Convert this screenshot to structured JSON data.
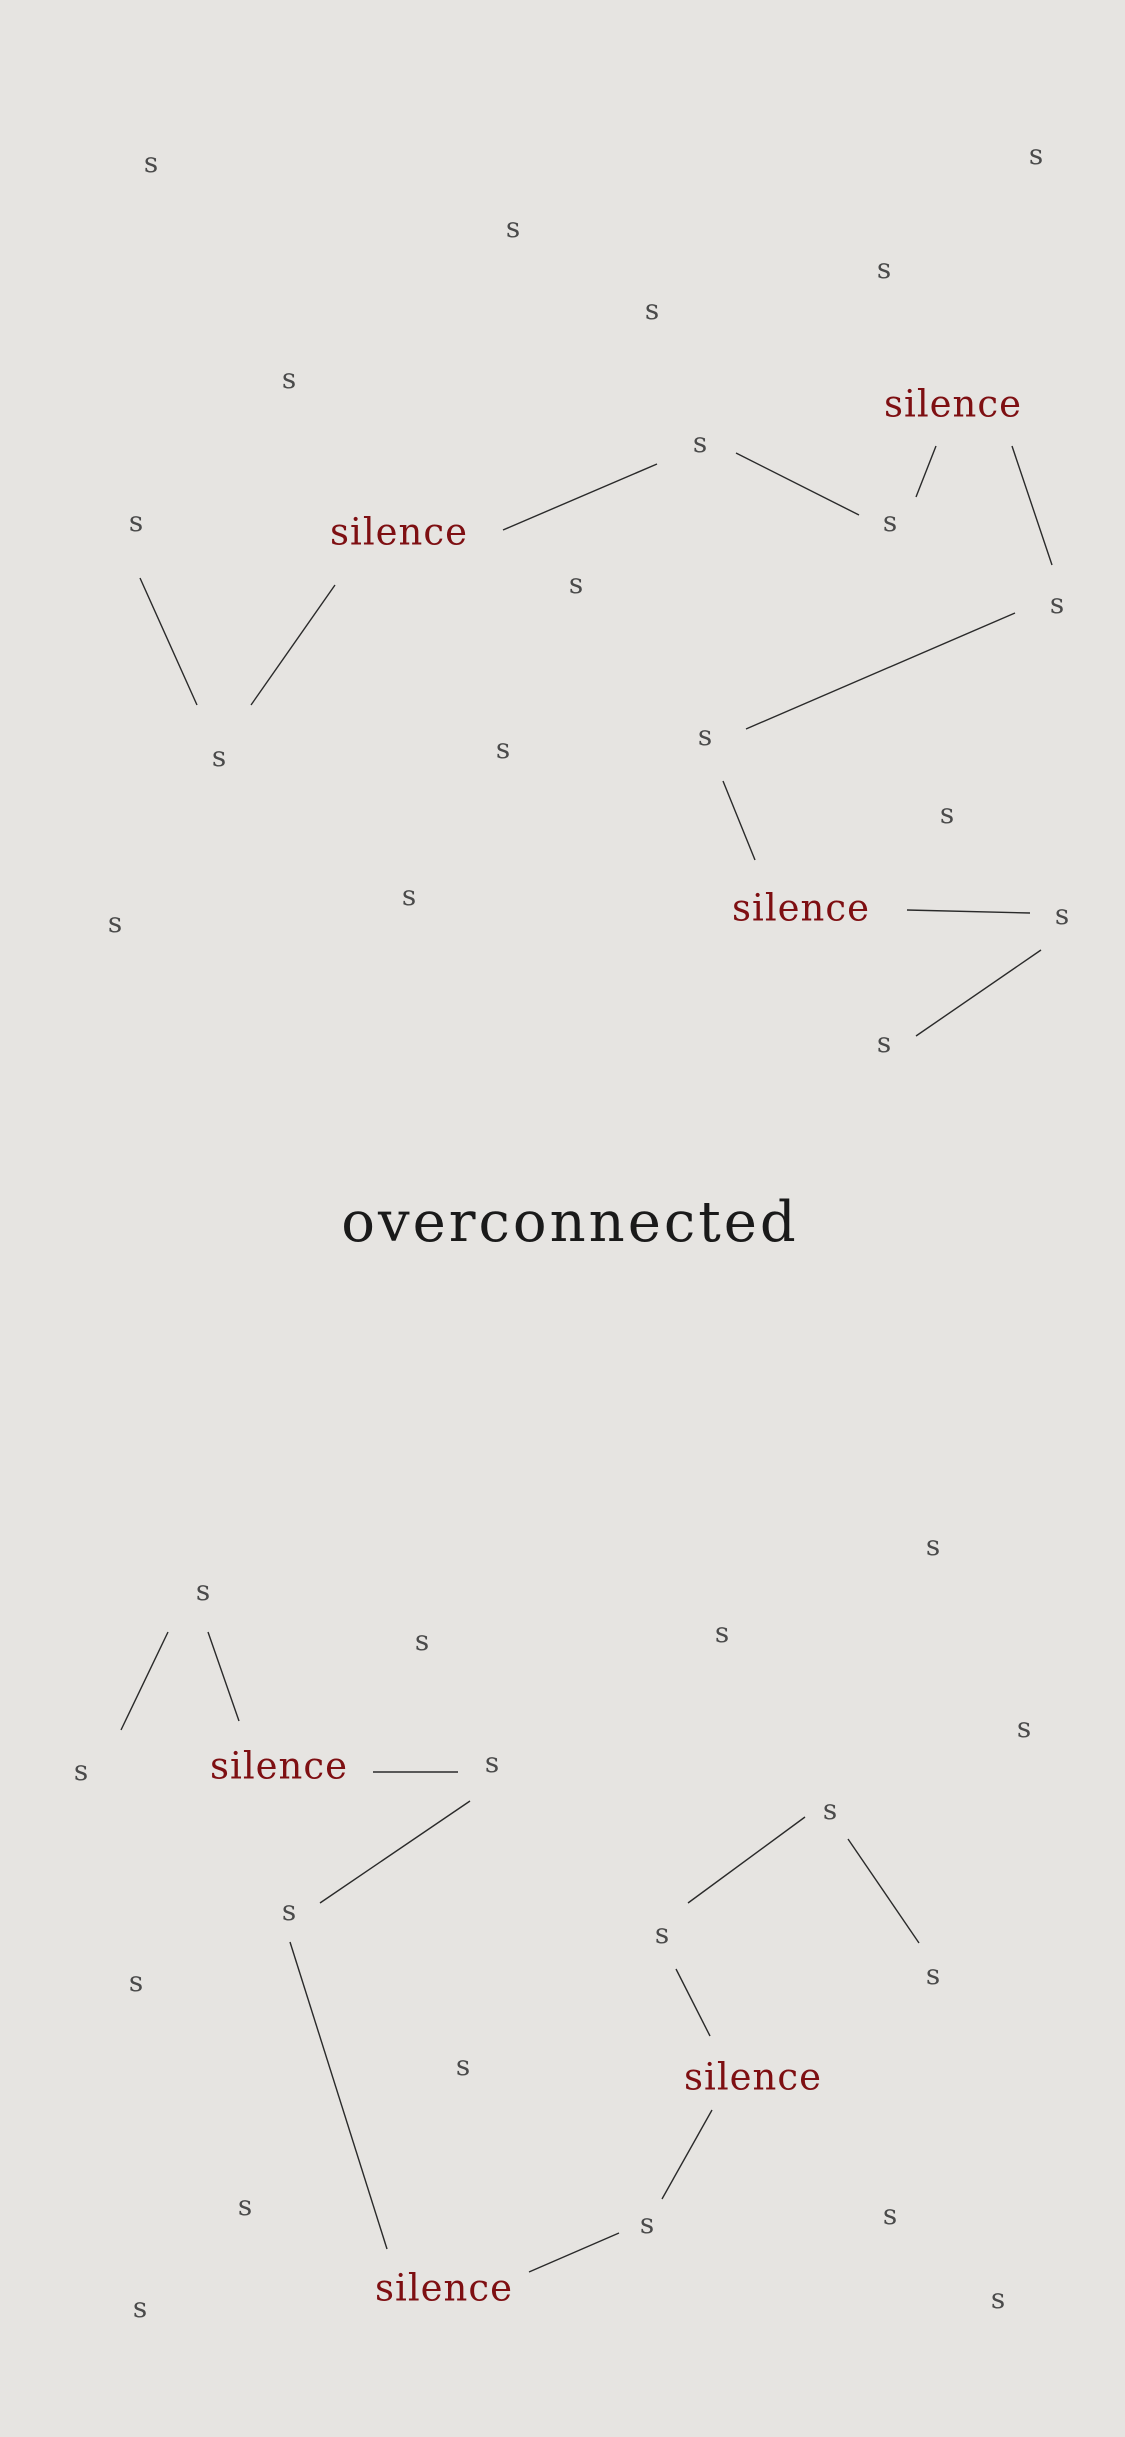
{
  "title": "overconnected",
  "colors": {
    "background": "#e6e4e1",
    "silence_word": "#7e0f12",
    "s_letter": "#4a4a4a",
    "title": "#1a1a1a",
    "connector_line": "#2a2a2a"
  },
  "text": {
    "s": "s",
    "silence": "silence"
  }
}
